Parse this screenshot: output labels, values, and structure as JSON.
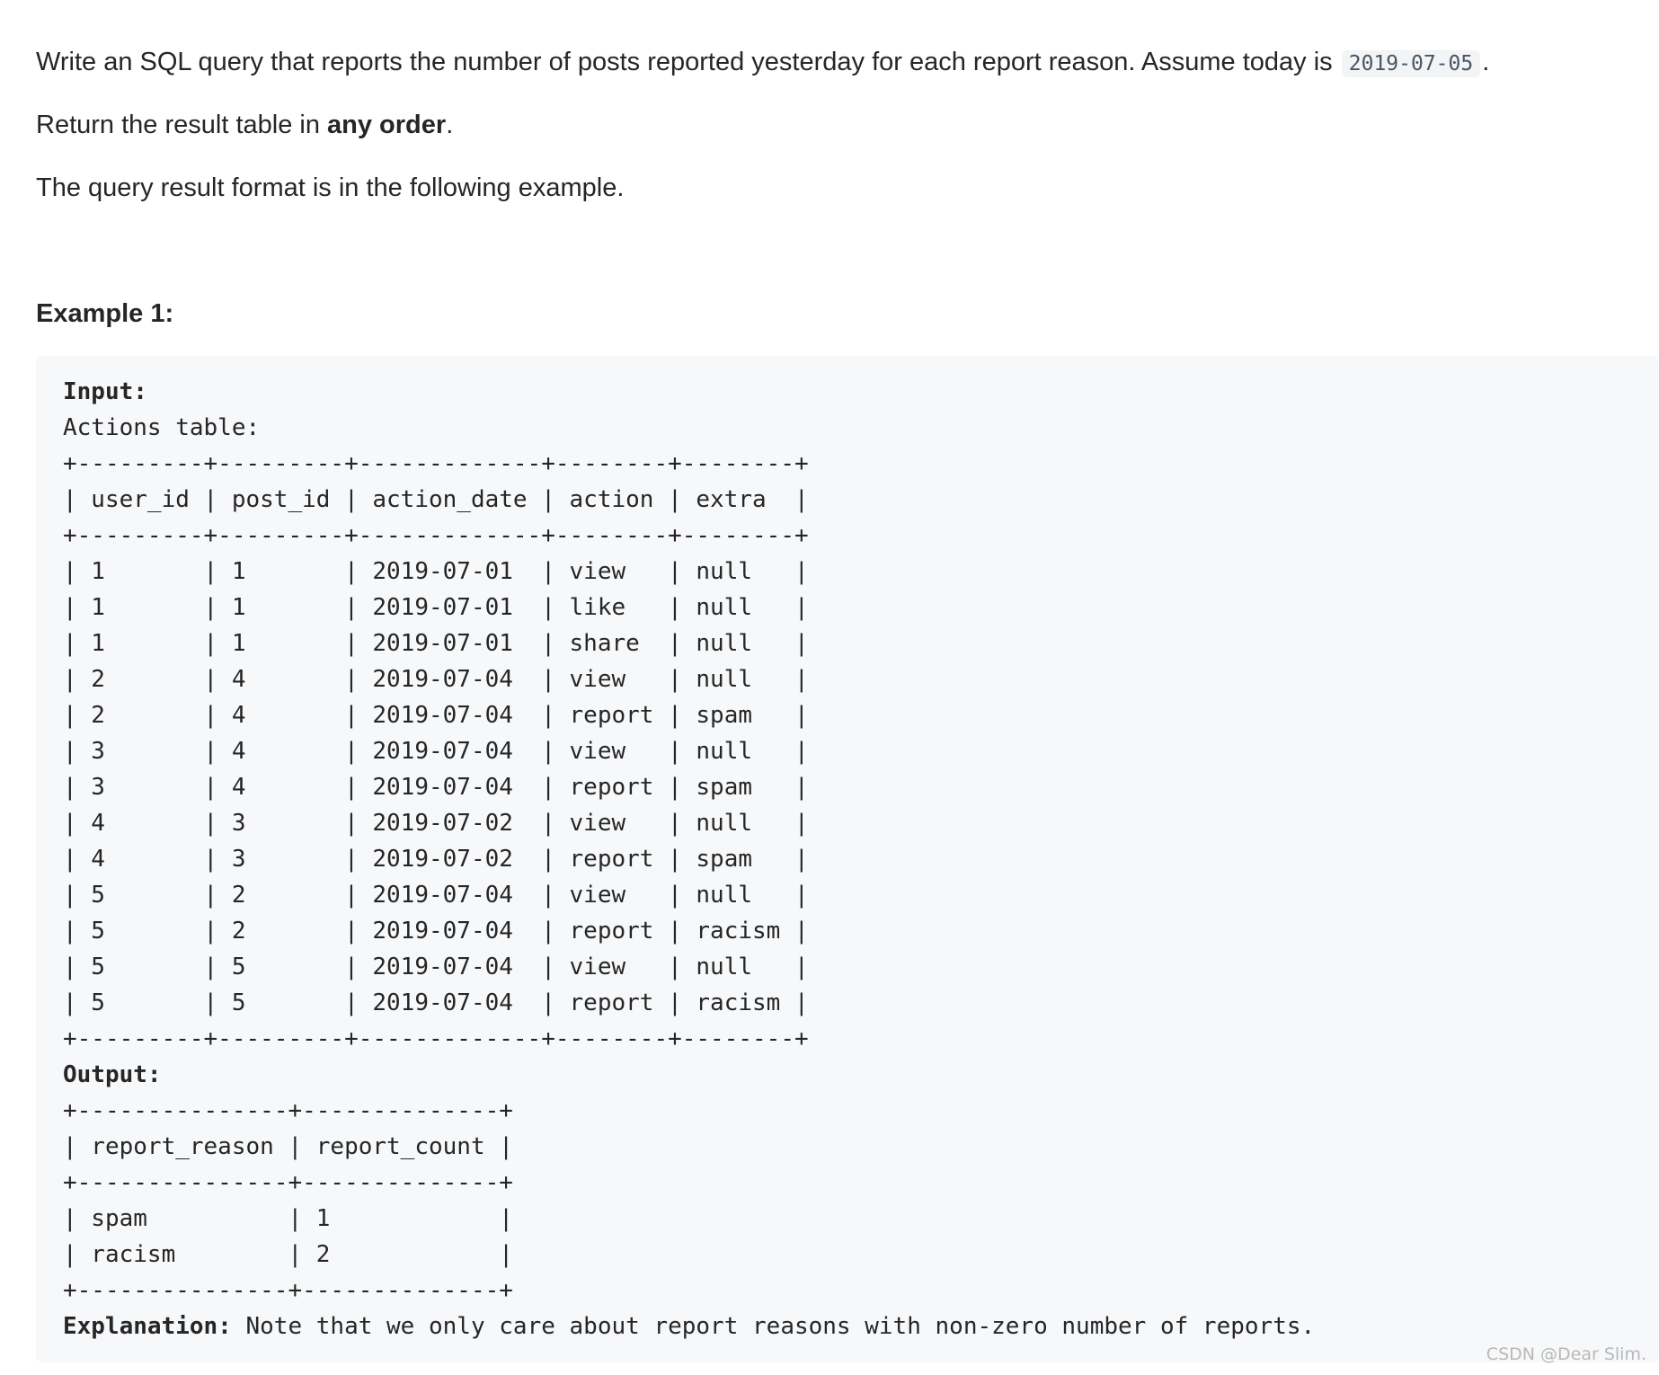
{
  "problem": {
    "para1_before_code": "Write an SQL query that reports the number of posts reported yesterday for each report reason. Assume today is ",
    "para1_code": "2019-07-05",
    "para1_after_code": ".",
    "para2_before_bold": "Return the result table in ",
    "para2_bold": "any order",
    "para2_after_bold": ".",
    "para3": "The query result format is in the following example."
  },
  "example": {
    "heading": "Example 1:",
    "input_label": "Input:",
    "input_table_caption": "Actions table:",
    "input_table_lines": [
      "+---------+---------+-------------+--------+--------+",
      "| user_id | post_id | action_date | action | extra  |",
      "+---------+---------+-------------+--------+--------+",
      "| 1       | 1       | 2019-07-01  | view   | null   |",
      "| 1       | 1       | 2019-07-01  | like   | null   |",
      "| 1       | 1       | 2019-07-01  | share  | null   |",
      "| 2       | 4       | 2019-07-04  | view   | null   |",
      "| 2       | 4       | 2019-07-04  | report | spam   |",
      "| 3       | 4       | 2019-07-04  | view   | null   |",
      "| 3       | 4       | 2019-07-04  | report | spam   |",
      "| 4       | 3       | 2019-07-02  | view   | null   |",
      "| 4       | 3       | 2019-07-02  | report | spam   |",
      "| 5       | 2       | 2019-07-04  | view   | null   |",
      "| 5       | 2       | 2019-07-04  | report | racism |",
      "| 5       | 5       | 2019-07-04  | view   | null   |",
      "| 5       | 5       | 2019-07-04  | report | racism |",
      "+---------+---------+-------------+--------+--------+"
    ],
    "output_label": "Output:",
    "output_table_lines": [
      "+---------------+--------------+",
      "| report_reason | report_count |",
      "+---------------+--------------+",
      "| spam          | 1            |",
      "| racism        | 2            |",
      "+---------------+--------------+"
    ],
    "explanation_label": "Explanation:",
    "explanation_text": " Note that we only care about report reasons with non-zero number of reports."
  },
  "watermark": "CSDN @Dear Slim."
}
